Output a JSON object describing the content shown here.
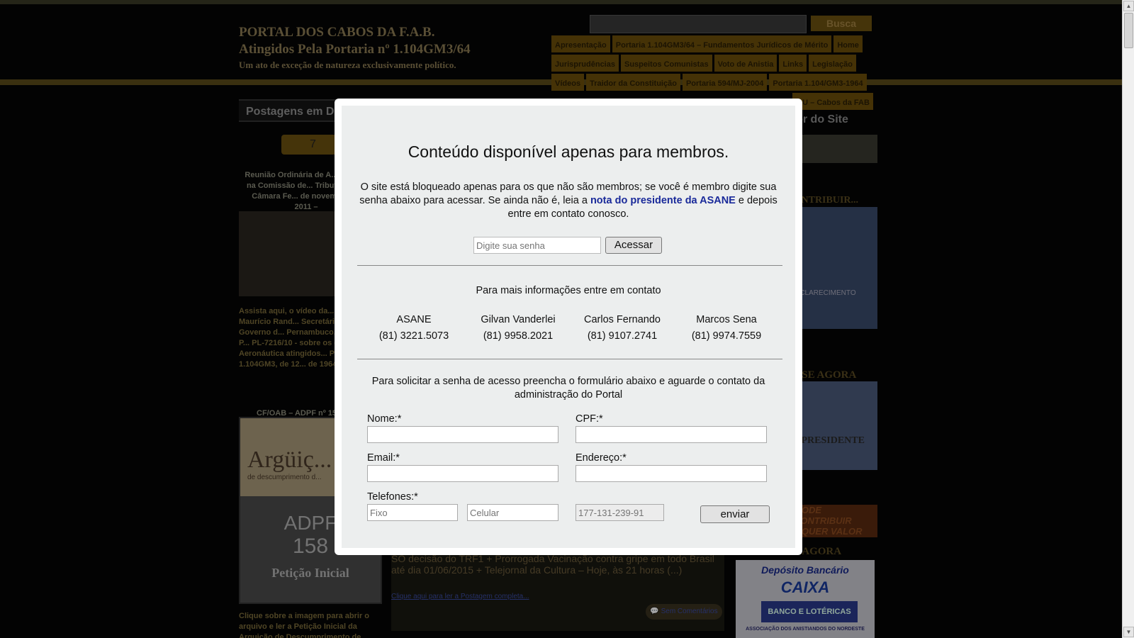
{
  "header": {
    "title_line1": "PORTAL DOS CABOS DA F.A.B.",
    "title_line2": "Atingidos Pela Portaria nº 1.104GM3/64",
    "subtitle": "Um ato de exceção de natureza exclusivamente político.",
    "search_button": "Busca"
  },
  "nav": {
    "row1": [
      "Apresentação",
      "Portaria 1.104GM3/64 – Fundamentos Jurídicos de Mérito",
      "Home"
    ],
    "row2": [
      "Jurisprudências",
      "Suspeitos Comunistas",
      "Voto de Anistia",
      "Links",
      "Legislação"
    ],
    "row3": [
      "Vídeos",
      "Traidor da Constituição",
      "Portaria 594/MJ-2004",
      "Portaria 1.104/GM3-1964"
    ],
    "row4": [
      "...U – Cabos da FAB"
    ]
  },
  "left": {
    "heading": "Postagens em D...",
    "badge_count": "7",
    "post1": "Reunião Ordinária de A... Pública na Comissão de... Tributação da Câmara Fe... de novembro de 2011 –",
    "post2": "Assista aqui, o vídeo da... Deputado Maurício Rand... Secretário de Governo d... Pernambuco, autor do P... PL-7216/10 - sobre os ex... da Aeronáutica atingidos... Portaria 1.104GM3, de 12... de 1964.",
    "post3_title": "CF/OAB – ADPF nº 15...",
    "poster_word": "Argüiç...",
    "poster_small": "de descumprimento d...",
    "poster_adpf": "ADPF",
    "poster_num": "158",
    "poster_caption": "Petição Inicial",
    "post3_desc": "Clique sobre a imagem para abrir o arquivo e ler a Petição Inicial da Arguição de Descumprimento de..."
  },
  "right": {
    "heading": "...dor do Site",
    "box1_label": "...CLARECIMENTO",
    "section_contribuir": "...NTRIBUIR...",
    "section_agora": "...SE AGORA",
    "presidente": "...PRESIDENTE",
    "contribuir_banner": "...ODE CONTRIBUIR ...QUER VALOR",
    "agora2": "...AGORA",
    "caixa_title": "Depósito Bancário",
    "caixa_brand": "CAIXA",
    "caixa_bar": "BANCO E LOTÉRICAS",
    "caixa_foot": "ASSOCIAÇÃO DOS ANISTIANDOS DO NORDESTE"
  },
  "middle": {
    "post_text": "SÓ decisão do TRF1 + Prorrogada Vacinação contra gripe em todo Brasil até dia 01/06/2015 + Telejornal da Cultura – Hoje, às 21 horas (...)",
    "read_more": "Clique aqui para ler a Postagem completa...",
    "comments": "Sem Comentários"
  },
  "modal": {
    "title": "Conteúdo disponível apenas para membros.",
    "text_before": "O site está bloqueado apenas para os que não são membros; se você é membro digite sua senha abaixo para acessar. Se ainda não é, leia a ",
    "link": "nota do presidente da ASANE",
    "text_after": " e depois entre em contato conosco.",
    "password_placeholder": "Digite sua senha",
    "access_button": "Acessar",
    "contact_heading": "Para mais informações entre em contato",
    "contacts": [
      {
        "name": "ASANE",
        "phone": "(81) 3221.5073"
      },
      {
        "name": "Gilvan Vanderlei",
        "phone": "(81) 9958.2021"
      },
      {
        "name": "Carlos Fernando",
        "phone": "(81) 9107.2741"
      },
      {
        "name": "Marcos Sena",
        "phone": "(81) 9974.7559"
      }
    ],
    "form_heading": "Para solicitar a senha de acesso preencha o formulário abaixo e aguarde o contato da administração do Portal",
    "labels": {
      "nome": "Nome:*",
      "cpf": "CPF:*",
      "email": "Email:*",
      "endereco": "Endereço:*",
      "telefones": "Telefones:*"
    },
    "placeholders": {
      "fixo": "Fixo",
      "celular": "Celular",
      "code": "177-131-239-91"
    },
    "send_button": "enviar"
  }
}
